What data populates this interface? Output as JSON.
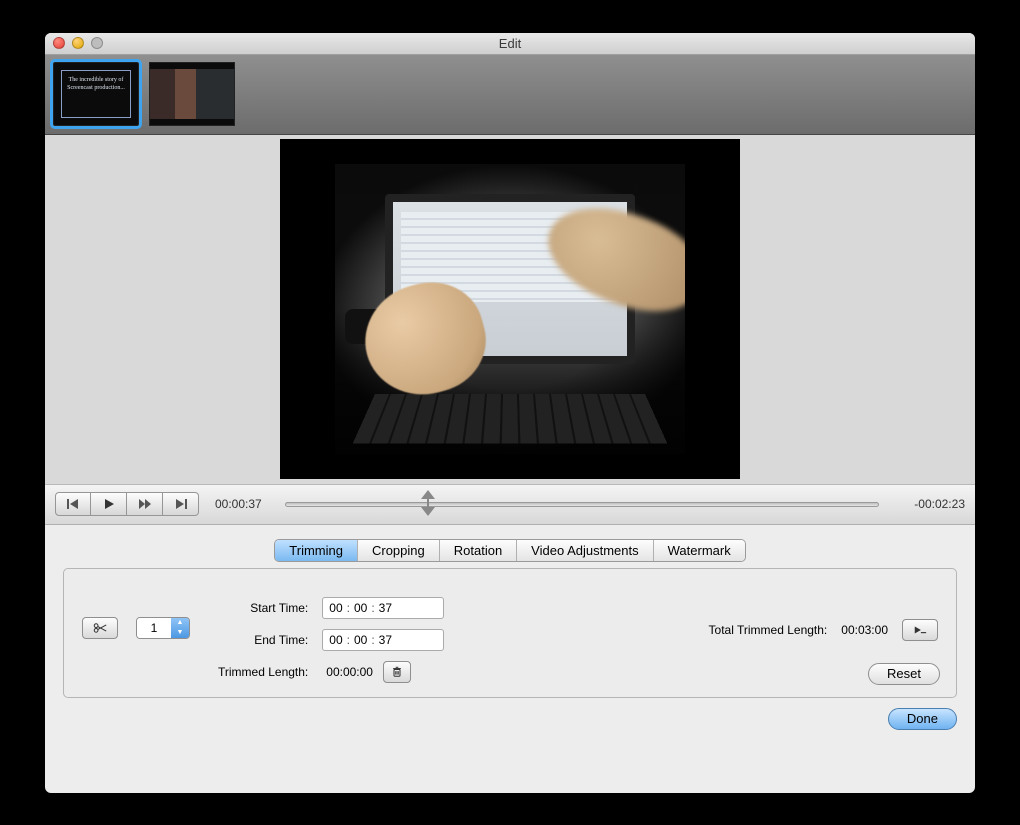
{
  "window": {
    "title": "Edit"
  },
  "thumbnails": {
    "slide1_text": "The incredible story of Screencast production..."
  },
  "playback": {
    "current": "00:00:37",
    "remaining": "-00:02:23",
    "progress_pct": 24
  },
  "tabs": {
    "trimming": "Trimming",
    "cropping": "Cropping",
    "rotation": "Rotation",
    "adjustments": "Video Adjustments",
    "watermark": "Watermark"
  },
  "trimming": {
    "segment_value": "1",
    "start_label": "Start Time:",
    "end_label": "End Time:",
    "trimmed_length_label": "Trimmed Length:",
    "total_label": "Total Trimmed Length:",
    "start": {
      "hh": "00",
      "mm": "00",
      "ss": "37"
    },
    "end": {
      "hh": "00",
      "mm": "00",
      "ss": "37"
    },
    "trimmed_length": "00:00:00",
    "total_trimmed": "00:03:00",
    "reset_label": "Reset"
  },
  "footer": {
    "done": "Done"
  }
}
